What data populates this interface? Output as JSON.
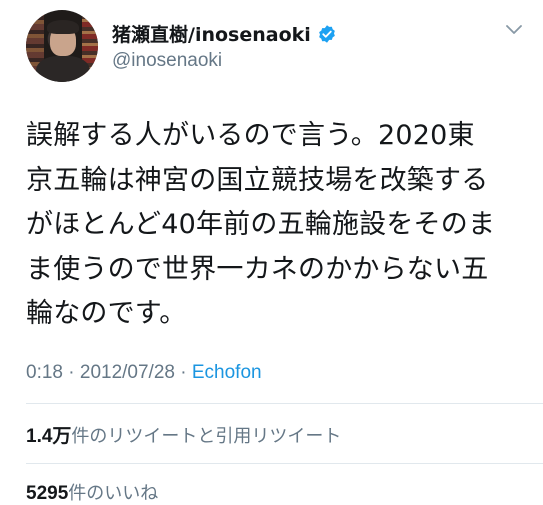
{
  "user": {
    "display_name": "猪瀬直樹/inosenaoki",
    "handle": "@inosenaoki",
    "verified": true
  },
  "tweet": {
    "lines": [
      "誤解する人がいるので言う。2020東",
      "京五輪は神宮の国立競技場を改築する",
      "がほとんど40年前の五輪施設をそのま",
      "ま使うので世界一カネのかからない五",
      "輪なのです。"
    ],
    "time": "0:18",
    "date": "2012/07/28",
    "separator1": "·",
    "separator2": "·",
    "source": "Echofon"
  },
  "stats": {
    "retweets_count": "1.4万",
    "retweets_label": "件のリツイートと引用リツイート",
    "likes_count": "5295",
    "likes_label": "件のいいね"
  },
  "colors": {
    "text": "#14171a",
    "secondary": "#657786",
    "link": "#1b95e0",
    "verified": "#1da1f2",
    "divider": "#e1e8ed"
  },
  "icons": {
    "verified": "verified-badge-icon",
    "caret": "chevron-down-icon"
  }
}
